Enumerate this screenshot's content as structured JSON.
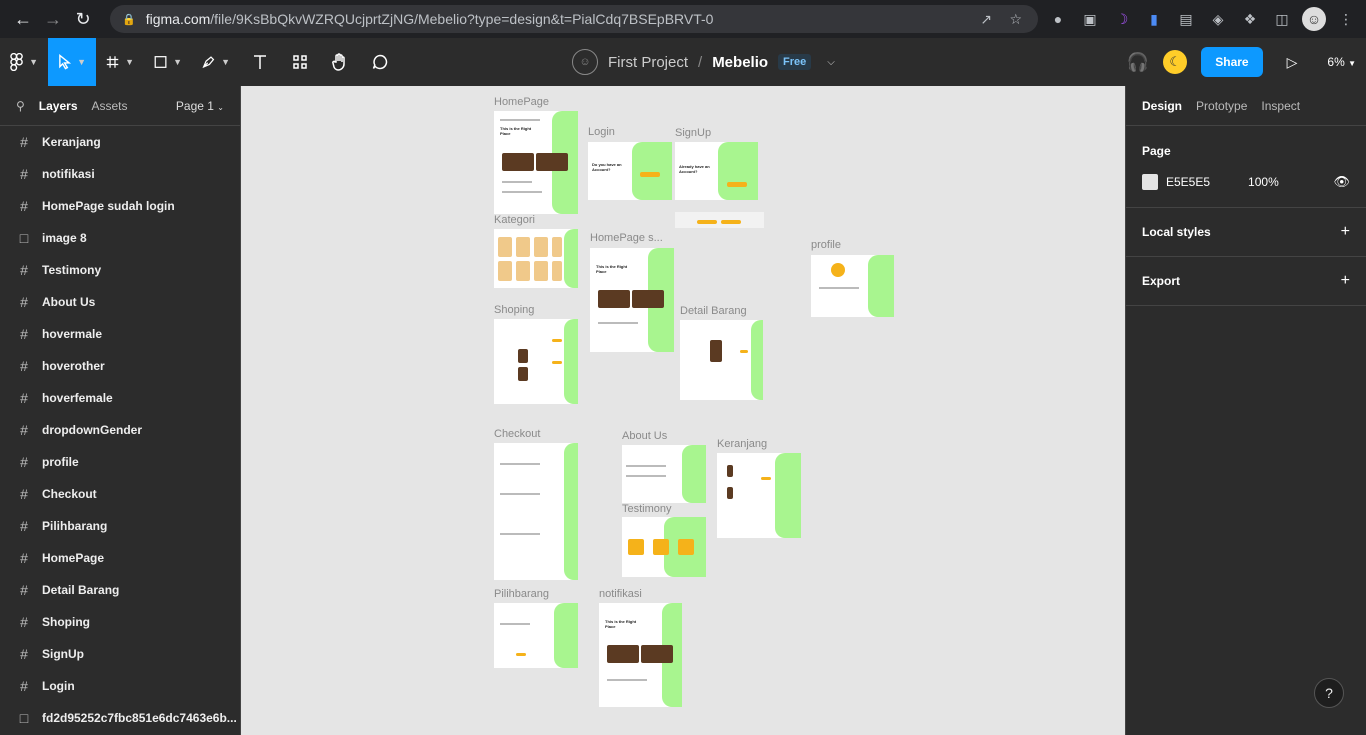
{
  "browser": {
    "url_host": "figma.com",
    "url_path": "/file/9KsBbQkvWZRQUcjprtZjNG/Mebelio?type=design&t=PialCdq7BSEpBRVT-0"
  },
  "header": {
    "project": "First Project",
    "separator": "/",
    "file_name": "Mebelio",
    "plan_badge": "Free",
    "share_label": "Share",
    "zoom": "6%"
  },
  "left_panel": {
    "tab_layers": "Layers",
    "tab_assets": "Assets",
    "page_select": "Page 1",
    "layers": [
      {
        "icon": "frame-icon",
        "name": "Keranjang"
      },
      {
        "icon": "frame-icon",
        "name": "notifikasi"
      },
      {
        "icon": "frame-icon",
        "name": "HomePage sudah login"
      },
      {
        "icon": "image-icon",
        "name": "image 8"
      },
      {
        "icon": "frame-icon",
        "name": "Testimony"
      },
      {
        "icon": "frame-icon",
        "name": "About Us"
      },
      {
        "icon": "frame-icon",
        "name": "hovermale"
      },
      {
        "icon": "frame-icon",
        "name": "hoverother"
      },
      {
        "icon": "frame-icon",
        "name": "hoverfemale"
      },
      {
        "icon": "frame-icon",
        "name": "dropdownGender"
      },
      {
        "icon": "frame-icon",
        "name": "profile"
      },
      {
        "icon": "frame-icon",
        "name": "Checkout"
      },
      {
        "icon": "frame-icon",
        "name": "Pilihbarang"
      },
      {
        "icon": "frame-icon",
        "name": "HomePage"
      },
      {
        "icon": "frame-icon",
        "name": "Detail Barang"
      },
      {
        "icon": "frame-icon",
        "name": "Shoping"
      },
      {
        "icon": "frame-icon",
        "name": "SignUp"
      },
      {
        "icon": "frame-icon",
        "name": "Login"
      },
      {
        "icon": "image-icon",
        "name": "fd2d95252c7fbc851e6dc7463e6b..."
      }
    ]
  },
  "canvas": {
    "background": "#E5E5E5",
    "frames": {
      "homepage": {
        "label": "HomePage",
        "hero": "This is the Right Place"
      },
      "login": {
        "label": "Login",
        "prompt": "Do you have an Account?"
      },
      "signup": {
        "label": "SignUp",
        "prompt": "Already have an Account?"
      },
      "kategori": {
        "label": "Kategori"
      },
      "homepage_s": {
        "label": "HomePage s...",
        "hero": "This is the Right Place"
      },
      "profile": {
        "label": "profile"
      },
      "shoping": {
        "label": "Shoping"
      },
      "detail_barang": {
        "label": "Detail Barang"
      },
      "checkout": {
        "label": "Checkout"
      },
      "about_us": {
        "label": "About Us"
      },
      "keranjang": {
        "label": "Keranjang"
      },
      "testimony": {
        "label": "Testimony"
      },
      "pilihbarang": {
        "label": "Pilihbarang"
      },
      "notifikasi": {
        "label": "notifikasi",
        "hero": "This is the Right Place"
      }
    }
  },
  "right_panel": {
    "tab_design": "Design",
    "tab_prototype": "Prototype",
    "tab_inspect": "Inspect",
    "page_heading": "Page",
    "page_color": "E5E5E5",
    "page_opacity": "100%",
    "local_styles": "Local styles",
    "export": "Export"
  },
  "help": "?",
  "colors": {
    "accent": "#0d99ff",
    "frame_green": "#a8f58f",
    "button_yellow": "#f5b21a"
  }
}
